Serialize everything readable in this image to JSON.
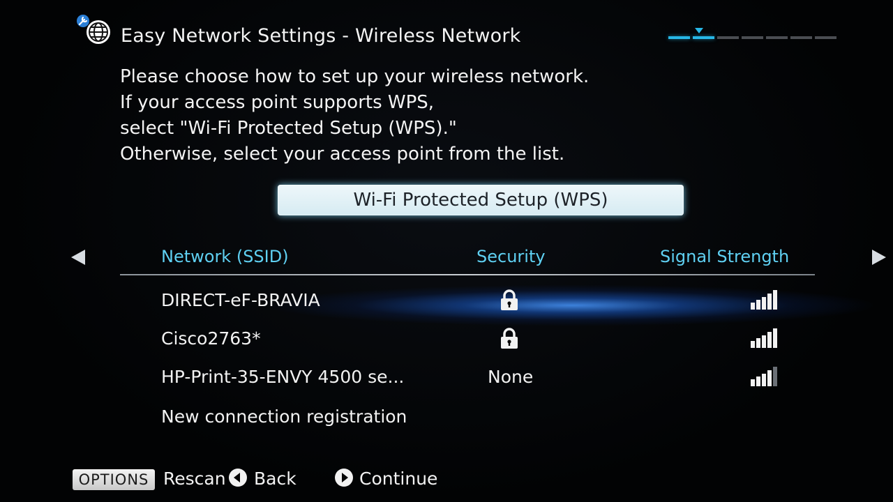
{
  "header": {
    "title": "Easy Network Settings - Wireless Network",
    "icon": "network-settings-icon",
    "progress_steps": 7,
    "progress_current_step": 2
  },
  "instructions": [
    "Please choose how to set up your wireless network.",
    "If your access point supports WPS,",
    "select \"Wi-Fi Protected Setup (WPS).\"",
    "Otherwise, select your access point from the list."
  ],
  "wps_button_label": "Wi-Fi Protected Setup (WPS)",
  "table": {
    "columns": [
      "Network (SSID)",
      "Security",
      "Signal Strength"
    ],
    "rows": [
      {
        "ssid": "DIRECT-eF-BRAVIA",
        "security": "lock-icon",
        "signal_bars": 5,
        "focused": true
      },
      {
        "ssid": "Cisco2763*",
        "security": "lock-icon",
        "signal_bars": 5,
        "focused": false
      },
      {
        "ssid": "HP-Print-35-ENVY 4500 se...",
        "security": "None",
        "signal_bars": 4,
        "focused": false
      },
      {
        "ssid": "New connection registration",
        "security": "",
        "signal_bars": 0,
        "focused": false
      }
    ]
  },
  "footer": {
    "options_label": "OPTIONS",
    "rescan_label": "Rescan",
    "back_label": "Back",
    "continue_label": "Continue"
  },
  "colors": {
    "accent": "#5fd0f2",
    "progress_active": "#27b7e6",
    "background": "#020304",
    "focus_glow": "#4696ff"
  }
}
